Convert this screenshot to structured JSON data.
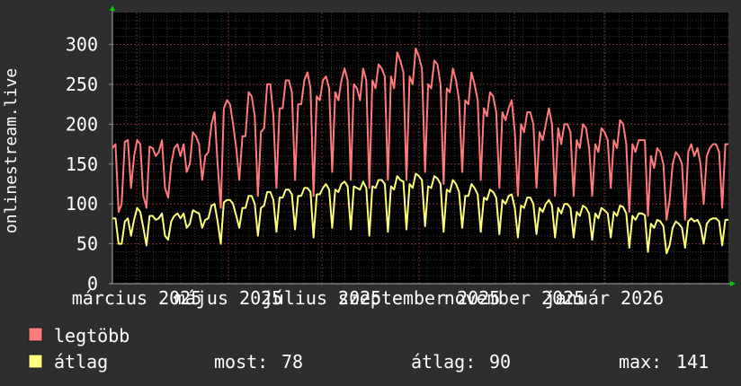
{
  "chart_data": {
    "type": "line",
    "ylabel": "onlinestream.live",
    "ylim": [
      0,
      340
    ],
    "y_ticks": [
      0,
      50,
      100,
      150,
      200,
      250,
      300
    ],
    "x_tick_labels": [
      "március 2025",
      "május 2025",
      "július 2025",
      "szeptember 2025",
      "november 2025",
      "január 2026"
    ],
    "grid": true,
    "series": [
      {
        "name": "legtöbb",
        "color": "#ff7b7b",
        "values": [
          170,
          175,
          90,
          100,
          178,
          180,
          120,
          160,
          180,
          175,
          110,
          95,
          172,
          170,
          160,
          165,
          180,
          120,
          108,
          150,
          170,
          175,
          160,
          175,
          140,
          150,
          190,
          185,
          175,
          130,
          160,
          165,
          200,
          215,
          150,
          95,
          220,
          230,
          225,
          200,
          170,
          130,
          185,
          185,
          240,
          235,
          210,
          110,
          190,
          195,
          250,
          250,
          210,
          120,
          220,
          220,
          255,
          255,
          240,
          130,
          225,
          225,
          255,
          265,
          245,
          110,
          235,
          230,
          255,
          260,
          245,
          140,
          240,
          230,
          255,
          270,
          255,
          130,
          250,
          245,
          230,
          270,
          255,
          120,
          255,
          245,
          275,
          270,
          260,
          130,
          260,
          245,
          290,
          280,
          265,
          130,
          260,
          250,
          295,
          285,
          270,
          140,
          250,
          245,
          280,
          275,
          250,
          125,
          245,
          240,
          270,
          255,
          230,
          140,
          230,
          225,
          265,
          250,
          230,
          130,
          220,
          210,
          240,
          235,
          215,
          120,
          215,
          205,
          220,
          230,
          190,
          110,
          200,
          190,
          215,
          215,
          200,
          120,
          190,
          180,
          200,
          220,
          200,
          110,
          195,
          175,
          200,
          200,
          190,
          110,
          180,
          170,
          200,
          195,
          170,
          110,
          175,
          165,
          195,
          190,
          180,
          120,
          180,
          170,
          205,
          200,
          175,
          90,
          175,
          165,
          180,
          180,
          180,
          85,
          160,
          145,
          170,
          165,
          150,
          80,
          105,
          150,
          165,
          160,
          150,
          80,
          165,
          175,
          160,
          170,
          150,
          100,
          160,
          170,
          175,
          175,
          165,
          95,
          175,
          175
        ]
      },
      {
        "name": "átlag",
        "color": "#ffff7a",
        "values": [
          82,
          82,
          50,
          50,
          78,
          82,
          60,
          80,
          95,
          90,
          70,
          48,
          85,
          85,
          80,
          82,
          88,
          60,
          55,
          78,
          85,
          88,
          82,
          88,
          70,
          75,
          92,
          90,
          88,
          70,
          80,
          82,
          98,
          100,
          78,
          50,
          102,
          105,
          105,
          100,
          85,
          70,
          95,
          95,
          110,
          110,
          100,
          60,
          95,
          98,
          115,
          115,
          105,
          65,
          108,
          108,
          118,
          118,
          112,
          68,
          110,
          110,
          120,
          120,
          115,
          58,
          112,
          112,
          120,
          125,
          118,
          70,
          118,
          115,
          125,
          128,
          122,
          68,
          122,
          120,
          118,
          128,
          120,
          60,
          122,
          120,
          130,
          130,
          125,
          65,
          122,
          118,
          135,
          130,
          128,
          68,
          125,
          120,
          138,
          135,
          130,
          72,
          122,
          120,
          135,
          132,
          125,
          65,
          118,
          115,
          130,
          125,
          115,
          70,
          110,
          110,
          125,
          120,
          112,
          65,
          108,
          105,
          118,
          115,
          108,
          62,
          105,
          100,
          110,
          112,
          95,
          58,
          98,
          95,
          108,
          108,
          100,
          62,
          95,
          90,
          100,
          105,
          98,
          58,
          95,
          88,
          100,
          100,
          95,
          58,
          90,
          85,
          98,
          95,
          88,
          55,
          88,
          82,
          95,
          92,
          88,
          58,
          90,
          85,
          98,
          96,
          88,
          45,
          85,
          80,
          88,
          88,
          86,
          40,
          75,
          70,
          80,
          78,
          72,
          38,
          48,
          70,
          78,
          75,
          70,
          45,
          78,
          82,
          78,
          80,
          72,
          50,
          75,
          80,
          82,
          82,
          78,
          48,
          80,
          80
        ]
      }
    ],
    "legend": [
      {
        "label": "legtöbb",
        "color": "#ff7b7b"
      },
      {
        "label": "átlag",
        "color": "#ffff7a"
      }
    ],
    "stats": {
      "now_label": "most:",
      "now_value": "78",
      "avg_label": "átlag:",
      "avg_value": "90",
      "max_label": "max:",
      "max_value": "141"
    }
  }
}
